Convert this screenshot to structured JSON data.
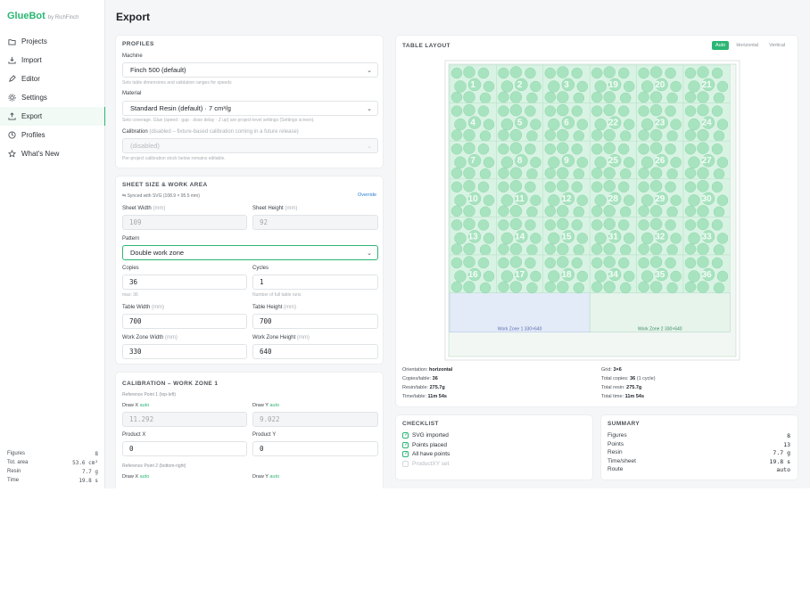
{
  "brand": {
    "name": "GlueBot",
    "by": "by RichFinch"
  },
  "nav": [
    {
      "label": "Projects",
      "icon": "folder-icon"
    },
    {
      "label": "Import",
      "icon": "import-icon"
    },
    {
      "label": "Editor",
      "icon": "pencil-icon"
    },
    {
      "label": "Settings",
      "icon": "gear-icon"
    },
    {
      "label": "Export",
      "icon": "export-icon",
      "active": true
    },
    {
      "label": "Profiles",
      "icon": "profiles-icon"
    },
    {
      "label": "What's New",
      "icon": "star-icon"
    }
  ],
  "stats": [
    {
      "label": "Figures",
      "value": "8"
    },
    {
      "label": "Tot. area",
      "value": "53.6 cm²"
    },
    {
      "label": "Resin",
      "value": "7.7 g"
    },
    {
      "label": "Time",
      "value": "19.8 s"
    }
  ],
  "page_title": "Export",
  "profiles": {
    "title": "Profiles",
    "machine_label": "Machine",
    "machine_value": "Finch 500 (default)",
    "machine_hint": "Sets table dimensions and validation ranges for speeds",
    "material_label": "Material",
    "material_value": "Standard Resin (default) · 7 cm³/g",
    "material_hint": "Sets coverage. Glue (speed · gap · dose delay · Z up) are project-level settings (Settings screen).",
    "calibration_label": "Calibration",
    "calibration_note": "(disabled – fixture-based calibration coming in a future release)",
    "calibration_value": "(disabled)",
    "calibration_hint": "Per-project calibration stock below remains editable."
  },
  "sheet": {
    "title": "Sheet size & work area",
    "synced": "Synced with SVG (108.9 × 95.5 mm)",
    "override": "Override",
    "sheet_width_label": "Sheet Width",
    "sheet_width_unit": "(mm)",
    "sheet_width_value": "109",
    "sheet_height_label": "Sheet Height",
    "sheet_height_unit": "(mm)",
    "sheet_height_value": "92",
    "pattern_label": "Pattern",
    "pattern_value": "Double work zone",
    "copies_label": "Copies",
    "copies_value": "36",
    "copies_hint": "max: 36",
    "cycles_label": "Cycles",
    "cycles_value": "1",
    "cycles_hint": "Number of full table runs",
    "table_width_label": "Table Width",
    "table_width_unit": "(mm)",
    "table_width_value": "700",
    "table_height_label": "Table Height",
    "table_height_unit": "(mm)",
    "table_height_value": "700",
    "wz_width_label": "Work Zone Width",
    "wz_width_unit": "(mm)",
    "wz_width_value": "330",
    "wz_height_label": "Work Zone Height",
    "wz_height_unit": "(mm)",
    "wz_height_value": "640"
  },
  "calibration": {
    "title": "Calibration – Work Zone 1",
    "ref1": "Reference Point 1",
    "ref1_sub": "(top-left)",
    "draw_x_label": "Draw X",
    "draw_y_label": "Draw Y",
    "auto": "auto",
    "draw_x_value": "11.292",
    "draw_y_value": "9.022",
    "product_x_label": "Product X",
    "product_y_label": "Product Y",
    "product_x_value": "0",
    "product_y_value": "0",
    "ref2": "Reference Point 2",
    "ref2_sub": "(bottom-right)",
    "draw_x2_label": "Draw X",
    "draw_y2_label": "Draw Y"
  },
  "layout": {
    "title": "Table Layout",
    "tabs": [
      "Auto",
      "Horizontal",
      "Vertical"
    ],
    "active_tab": "Auto",
    "numbers": [
      "1",
      "2",
      "3",
      "19",
      "20",
      "21",
      "4",
      "5",
      "6",
      "22",
      "23",
      "24",
      "7",
      "8",
      "9",
      "25",
      "26",
      "27",
      "10",
      "11",
      "12",
      "28",
      "29",
      "30",
      "13",
      "14",
      "15",
      "31",
      "32",
      "33",
      "16",
      "17",
      "18",
      "34",
      "35",
      "36"
    ],
    "zone1_label": "Work Zone 1 330×640",
    "zone2_label": "Work Zone 2 330×640",
    "colors": {
      "cell": "#d8f3e3",
      "shape": "#a7e3bf",
      "zone1": "#e3ebf8",
      "zone2": "#e6f4ec"
    }
  },
  "layout_info": {
    "orientation_label": "Orientation:",
    "orientation_value": "horizontal",
    "copies_label": "Copies/table:",
    "copies_value": "36",
    "resin_label": "Resin/table:",
    "resin_value": "275.7g",
    "time_label": "Time/table:",
    "time_value": "11m 54s",
    "grid_label": "Grid:",
    "grid_value": "3×6",
    "total_copies_label": "Total copies:",
    "total_copies_value": "36",
    "total_copies_note": "(1 cycle)",
    "total_resin_label": "Total resin:",
    "total_resin_value": "275.7g",
    "total_time_label": "Total time:",
    "total_time_value": "11m 54s"
  },
  "checklist": {
    "title": "Checklist",
    "items": [
      {
        "label": "SVG imported",
        "done": true
      },
      {
        "label": "Points placed",
        "done": true
      },
      {
        "label": "All have points",
        "done": true
      },
      {
        "label": "ProductXY set",
        "done": false
      }
    ]
  },
  "summary": {
    "title": "Summary",
    "rows": [
      {
        "label": "Figures",
        "value": "8"
      },
      {
        "label": "Points",
        "value": "13"
      },
      {
        "label": "Resin",
        "value": "7.7 g"
      },
      {
        "label": "Time/sheet",
        "value": "19.8 s"
      },
      {
        "label": "Route",
        "value": "auto"
      }
    ]
  }
}
